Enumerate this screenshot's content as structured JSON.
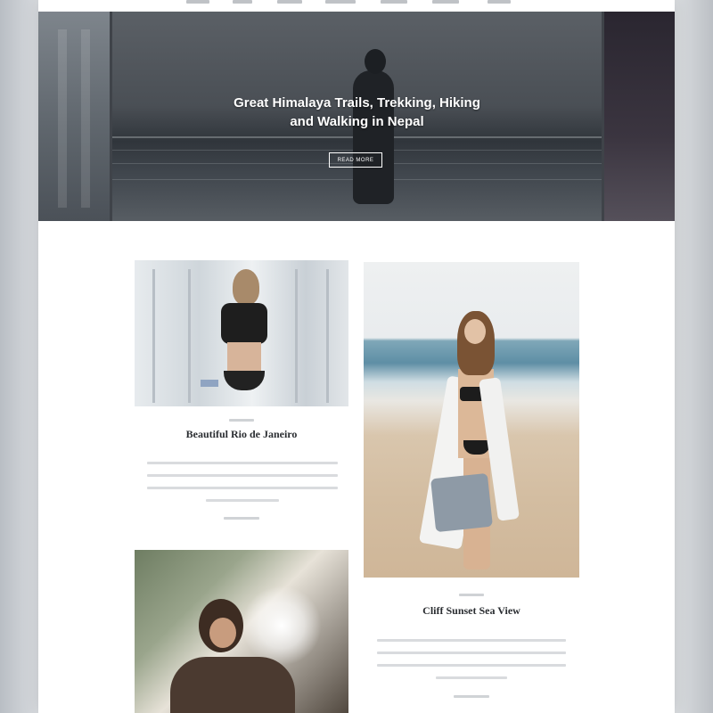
{
  "nav": {
    "items": [
      "Home",
      "Travel",
      "Lifestyle",
      "Fashion",
      "Beauty",
      "Features",
      "Contact"
    ]
  },
  "hero": {
    "title_line1": "Great Himalaya Trails, Trekking, Hiking",
    "title_line2": "and Walking in Nepal",
    "button_label": "READ MORE"
  },
  "posts": [
    {
      "title": "Beautiful Rio de Janeiro"
    },
    {
      "title": "Cliff Sunset Sea View"
    },
    {
      "title": ""
    }
  ],
  "colors": {
    "accent": "#2a2d31",
    "hero_text": "#ffffff",
    "page_background": "#ffffff"
  }
}
